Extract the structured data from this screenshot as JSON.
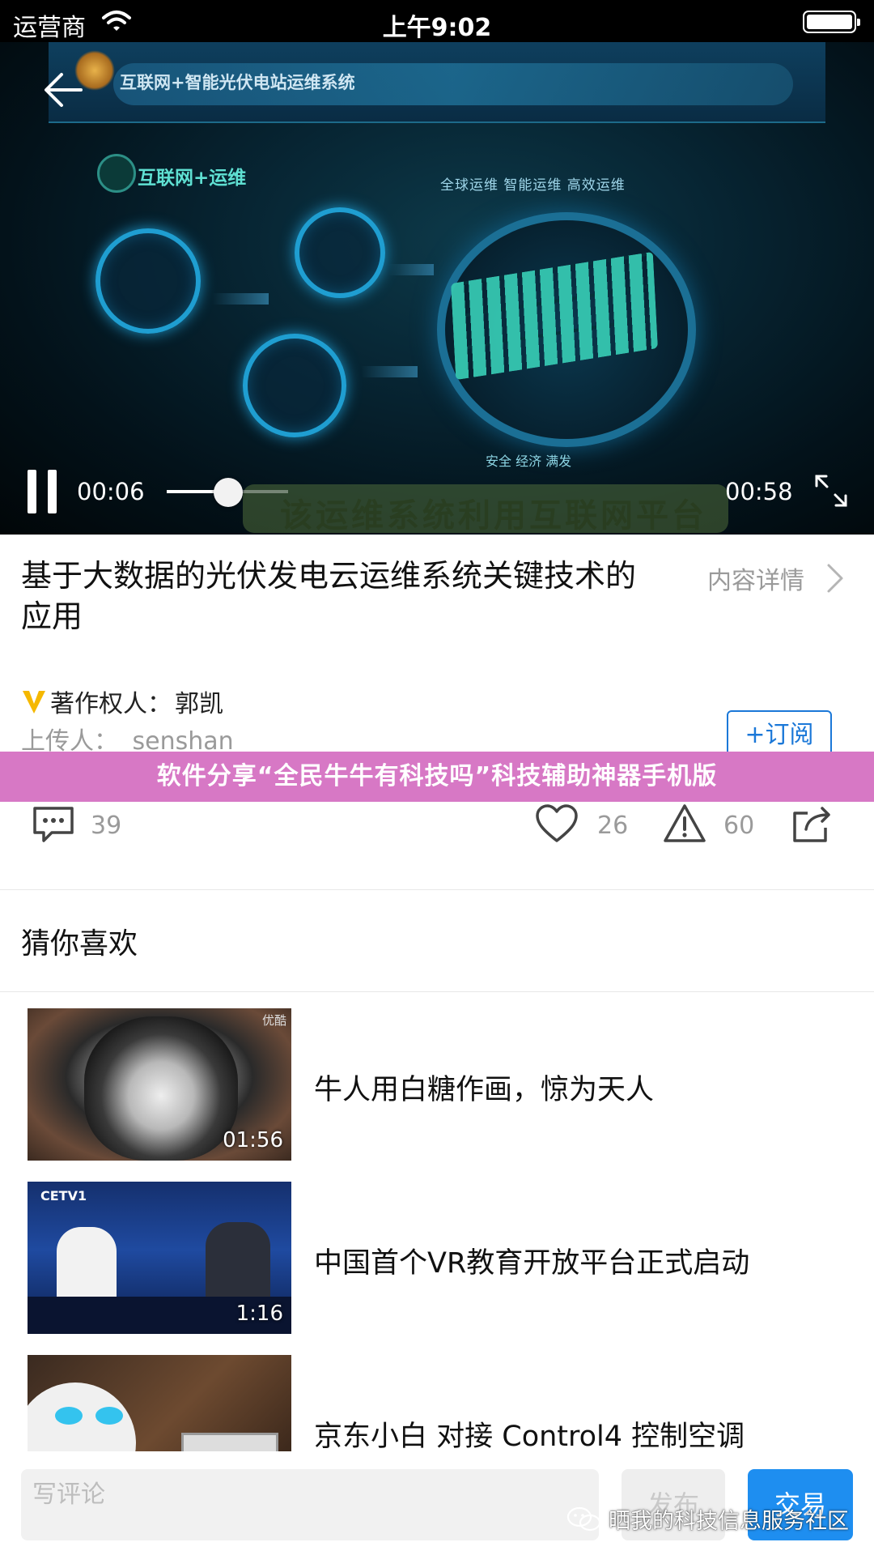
{
  "status_bar": {
    "carrier": "运营商",
    "time": "上午9:02"
  },
  "video": {
    "frame": {
      "header": "互联网+智能光伏电站运维系统",
      "section": "互联网+运维",
      "tags": "全球运维  智能运维  高效运维",
      "bottom_tags": "安全  经济  满发",
      "subtitle": "该运维系统利用互联网平台"
    },
    "current_time": "00:06",
    "duration": "00:58",
    "progress": 0.1
  },
  "content": {
    "title": "基于大数据的光伏发电云运维系统关键技术的应用",
    "detail_link": "内容详情",
    "author_label": "著作权人：",
    "author_name": "郭凯",
    "uploader_label": "上传人：",
    "uploader_name": "senshan",
    "subscribe_label": "+订阅"
  },
  "promo_banner": "软件分享“全民牛牛有科技吗”科技辅助神器手机版",
  "actions": {
    "comment_count": "39",
    "like_count": "26",
    "report_count": "60"
  },
  "recommend": {
    "section_title": "猜你喜欢",
    "items": [
      {
        "title": "牛人用白糖作画，惊为天人",
        "duration": "01:56",
        "thumb_logo": "优酷"
      },
      {
        "title": "中国首个VR教育开放平台正式启动",
        "duration": "1:16",
        "thumb_logo": "CETV1"
      },
      {
        "title": "京东小白 对接 Control4 控制空调",
        "duration": "",
        "thumb_logo": ""
      }
    ]
  },
  "bottom_bar": {
    "comment_placeholder": "写评论",
    "publish_label": "发布",
    "trade_label": "交易"
  },
  "watermark": "晒我的科技信息服务社区",
  "colors": {
    "accent": "#1e8ef0",
    "banner": "#d778c5",
    "badge": "#f5b800"
  }
}
